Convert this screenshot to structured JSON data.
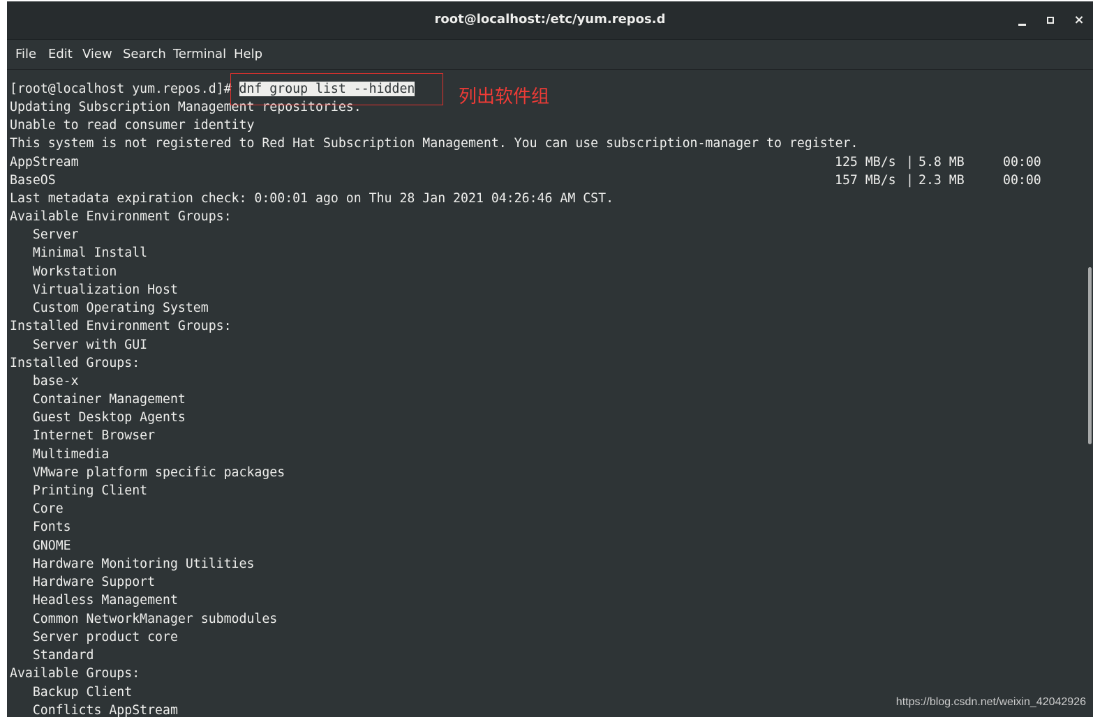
{
  "window": {
    "title": "root@localhost:/etc/yum.repos.d",
    "controls": {
      "minimize_icon": "minimize-icon",
      "maximize_icon": "maximize-icon",
      "close_glyph": "×"
    }
  },
  "menu": {
    "items": [
      "File",
      "Edit",
      "View",
      "Search",
      "Terminal",
      "Help"
    ]
  },
  "terminal": {
    "prompt": "[root@localhost yum.repos.d]# ",
    "command": "dnf group list --hidden",
    "lines": [
      "Updating Subscription Management repositories.",
      "Unable to read consumer identity",
      "This system is not registered to Red Hat Subscription Management. You can use subscription-manager to register.",
      "AppStream",
      "BaseOS",
      "Last metadata expiration check: 0:00:01 ago on Thu 28 Jan 2021 04:26:46 AM CST.",
      "Available Environment Groups:",
      "   Server",
      "   Minimal Install",
      "   Workstation",
      "   Virtualization Host",
      "   Custom Operating System",
      "Installed Environment Groups:",
      "   Server with GUI",
      "Installed Groups:",
      "   base-x",
      "   Container Management",
      "   Guest Desktop Agents",
      "   Internet Browser",
      "   Multimedia",
      "   VMware platform specific packages",
      "   Printing Client",
      "   Core",
      "   Fonts",
      "   GNOME",
      "   Hardware Monitoring Utilities",
      "   Hardware Support",
      "   Headless Management",
      "   Common NetworkManager submodules",
      "   Server product core",
      "   Standard",
      "Available Groups:",
      "   Backup Client",
      "   Conflicts AppStream"
    ],
    "repo_stats": [
      {
        "speed": "125 MB/s",
        "sep": "|",
        "size": "5.8 MB",
        "time": "00:00"
      },
      {
        "speed": "157 MB/s",
        "sep": "|",
        "size": "2.3 MB",
        "time": "00:00"
      }
    ]
  },
  "annotation": {
    "label": "列出软件组",
    "color": "#e0312d"
  },
  "watermark": "https://blog.csdn.net/weixin_42042926",
  "colors": {
    "terminal_bg": "#2e3436",
    "terminal_fg": "#eeeeec",
    "titlebar_bg": "#272c2e",
    "annotation": "#e0312d"
  }
}
